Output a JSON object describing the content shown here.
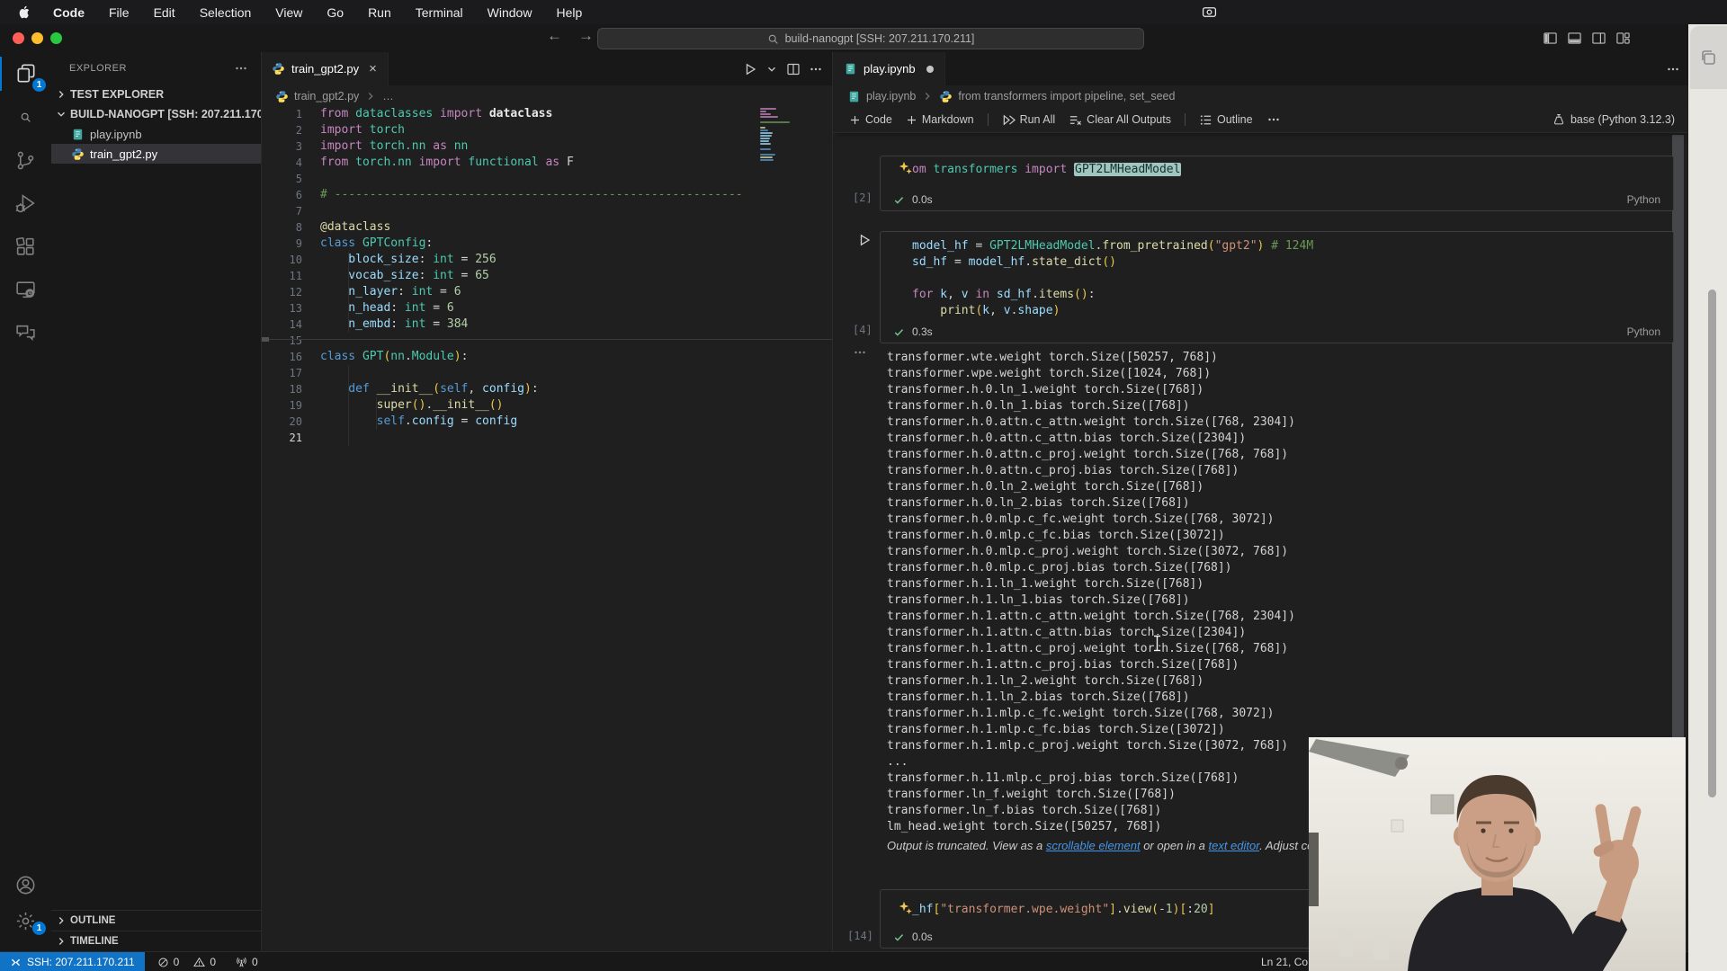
{
  "colors": {
    "accent_blue": "#0078d4",
    "check_green": "#73c991",
    "link_blue": "#4596e8",
    "remote_bg": "#1173c5"
  },
  "menu_bar": {
    "items": [
      "Code",
      "File",
      "Edit",
      "Selection",
      "View",
      "Go",
      "Run",
      "Terminal",
      "Window",
      "Help"
    ]
  },
  "title_bar": {
    "window_title": "build-nanogpt [SSH: 207.211.170.211]",
    "back": "←",
    "forward": "→",
    "layout_buttons": [
      {
        "icon": "layout-sidebar-icon",
        "name": "toggle-primary-sidebar"
      },
      {
        "icon": "layout-panel-icon",
        "name": "toggle-panel"
      },
      {
        "icon": "layout-secondary-icon",
        "name": "toggle-secondary-sidebar"
      },
      {
        "icon": "layout-customize-icon",
        "name": "customize-layout"
      }
    ]
  },
  "activity_bar": {
    "top": [
      {
        "name": "explorer",
        "icon": "files-icon",
        "active": true,
        "badge": "1"
      },
      {
        "name": "search",
        "icon": "search-icon"
      },
      {
        "name": "source-control",
        "icon": "source-control-icon"
      },
      {
        "name": "run-debug",
        "icon": "debug-icon"
      },
      {
        "name": "extensions",
        "icon": "extensions-icon"
      },
      {
        "name": "remote-explorer",
        "icon": "remote-explorer-icon"
      },
      {
        "name": "comments",
        "icon": "comments-icon"
      }
    ],
    "bottom": [
      {
        "name": "accounts",
        "icon": "account-icon"
      },
      {
        "name": "settings",
        "icon": "gear-icon",
        "badge": "1"
      }
    ]
  },
  "sidebar": {
    "title": "EXPLORER",
    "more": "more-icon",
    "sections": [
      {
        "label": "TEST EXPLORER",
        "collapsed": true
      },
      {
        "label": "BUILD-NANOGPT [SSH: 207.211.170....",
        "collapsed": false
      }
    ],
    "files": [
      {
        "label": "play.ipynb",
        "icon": "notebook-icon"
      },
      {
        "label": "train_gpt2.py",
        "icon": "python-icon",
        "selected": true
      }
    ],
    "bottom_sections": [
      {
        "label": "OUTLINE"
      },
      {
        "label": "TIMELINE"
      }
    ]
  },
  "editor": {
    "tab_label": "train_gpt2.py",
    "tab_close": "×",
    "actions": [
      {
        "icon": "run-icon",
        "name": "run-python-file-button"
      },
      {
        "icon": "chevron-down-icon",
        "name": "run-dropdown-button"
      },
      {
        "icon": "split-icon",
        "name": "split-editor-button"
      },
      {
        "icon": "more-icon",
        "name": "editor-more-button"
      }
    ],
    "breadcrumb": [
      {
        "icon": "python-icon",
        "label": "train_gpt2.py"
      },
      {
        "label": "…"
      }
    ],
    "lines": [
      {
        "t": [
          [
            "from",
            "kw"
          ],
          [
            " dataclasses",
            "type"
          ],
          [
            " import",
            "kw"
          ],
          [
            " dataclass",
            "fgb"
          ]
        ]
      },
      {
        "t": [
          [
            "import",
            "kw"
          ],
          [
            " torch",
            "type"
          ]
        ]
      },
      {
        "t": [
          [
            "import",
            "kw"
          ],
          [
            " torch.nn",
            "type"
          ],
          [
            " as",
            "kw"
          ],
          [
            " nn",
            "type"
          ]
        ]
      },
      {
        "t": [
          [
            "from",
            "kw"
          ],
          [
            " torch.nn",
            "type"
          ],
          [
            " import",
            "kw"
          ],
          [
            " functional",
            "type"
          ],
          [
            " as",
            "kw"
          ],
          [
            " F",
            "fg"
          ]
        ]
      },
      {
        "t": []
      },
      {
        "t": [
          [
            "# ----------------------------------------------------------",
            "com"
          ]
        ]
      },
      {
        "t": []
      },
      {
        "t": [
          [
            "@dataclass",
            "func"
          ]
        ]
      },
      {
        "t": [
          [
            "class",
            "ctrl"
          ],
          [
            " GPTConfig",
            "type"
          ],
          [
            ":",
            "fg"
          ]
        ]
      },
      {
        "t": [
          [
            "    block_size",
            "var"
          ],
          [
            ":",
            "fg"
          ],
          [
            " int",
            "type"
          ],
          [
            " = ",
            "fg"
          ],
          [
            "256",
            "num"
          ]
        ]
      },
      {
        "t": [
          [
            "    vocab_size",
            "var"
          ],
          [
            ":",
            "fg"
          ],
          [
            " int",
            "type"
          ],
          [
            " = ",
            "fg"
          ],
          [
            "65",
            "num"
          ]
        ]
      },
      {
        "t": [
          [
            "    n_layer",
            "var"
          ],
          [
            ":",
            "fg"
          ],
          [
            " int",
            "type"
          ],
          [
            " = ",
            "fg"
          ],
          [
            "6",
            "num"
          ]
        ]
      },
      {
        "t": [
          [
            "    n_head",
            "var"
          ],
          [
            ":",
            "fg"
          ],
          [
            " int",
            "type"
          ],
          [
            " = ",
            "fg"
          ],
          [
            "6",
            "num"
          ]
        ]
      },
      {
        "t": [
          [
            "    n_embd",
            "var"
          ],
          [
            ":",
            "fg"
          ],
          [
            " int",
            "type"
          ],
          [
            " = ",
            "fg"
          ],
          [
            "384",
            "num"
          ]
        ]
      },
      {
        "t": []
      },
      {
        "t": [
          [
            "class",
            "ctrl"
          ],
          [
            " GPT",
            "type"
          ],
          [
            "(",
            "par"
          ],
          [
            "nn",
            "type"
          ],
          [
            ".",
            "fg"
          ],
          [
            "Module",
            "type"
          ],
          [
            ")",
            "par"
          ],
          [
            ":",
            "fg"
          ]
        ]
      },
      {
        "t": []
      },
      {
        "t": [
          [
            "    def",
            "ctrl"
          ],
          [
            " __init__",
            "func"
          ],
          [
            "(",
            "par"
          ],
          [
            "self",
            "ctrl"
          ],
          [
            ",",
            "fg"
          ],
          [
            " config",
            "var"
          ],
          [
            ")",
            "par"
          ],
          [
            ":",
            "fg"
          ]
        ]
      },
      {
        "t": [
          [
            "        super",
            "func"
          ],
          [
            "()",
            "par"
          ],
          [
            ".",
            "fg"
          ],
          [
            "__init__",
            "func"
          ],
          [
            "()",
            "par"
          ]
        ]
      },
      {
        "t": [
          [
            "        self",
            "ctrl"
          ],
          [
            ".",
            "fg"
          ],
          [
            "config",
            "var"
          ],
          [
            " = ",
            "fg"
          ],
          [
            "config",
            "var"
          ]
        ]
      },
      {
        "t": []
      }
    ]
  },
  "notebook": {
    "tab_label": "play.ipynb",
    "breadcrumb": [
      {
        "icon": "notebook-icon",
        "label": "play.ipynb"
      },
      {
        "icon": "python-icon",
        "label": "from transformers import pipeline, set_seed"
      }
    ],
    "toolbar": [
      {
        "icon": "add-icon",
        "label": "Code"
      },
      {
        "icon": "add-icon",
        "label": "Markdown"
      },
      {
        "sep": true
      },
      {
        "icon": "run-all-icon",
        "label": "Run All"
      },
      {
        "icon": "clear-outputs-icon",
        "label": "Clear All Outputs"
      },
      {
        "sep": true
      },
      {
        "icon": "outline-icon",
        "label": "Outline"
      },
      {
        "icon": "more-icon",
        "label": ""
      }
    ],
    "kernel": "base (Python 3.12.3)",
    "cells": [
      {
        "exec": "[2]",
        "time": "0.0s",
        "lang": "Python",
        "sparkle": true,
        "code": [
          [
            [
              "om",
              "kw"
            ],
            [
              " transformers",
              "type"
            ],
            [
              " import",
              "kw"
            ],
            [
              " ",
              "fg"
            ],
            [
              "GPT2LMHeadModel",
              "hl"
            ]
          ]
        ]
      },
      {
        "exec": "[4]",
        "time": "0.3s",
        "lang": "Python",
        "run_button": true,
        "code": [
          [
            [
              "model_hf",
              "var"
            ],
            [
              " = ",
              "fg"
            ],
            [
              "GPT2LMHeadModel",
              "type"
            ],
            [
              ".",
              "fg"
            ],
            [
              "from_pretrained",
              "func"
            ],
            [
              "(",
              "par"
            ],
            [
              "\"gpt2\"",
              "str"
            ],
            [
              ")",
              "par"
            ],
            [
              " # 124M",
              "com"
            ]
          ],
          [
            [
              "sd_hf",
              "var"
            ],
            [
              " = ",
              "fg"
            ],
            [
              "model_hf",
              "var"
            ],
            [
              ".",
              "fg"
            ],
            [
              "state_dict",
              "func"
            ],
            [
              "()",
              "par"
            ]
          ],
          [],
          [
            [
              "for",
              "kw"
            ],
            [
              " k",
              "var"
            ],
            [
              ", ",
              "fg"
            ],
            [
              "v",
              "var"
            ],
            [
              " in",
              "kw"
            ],
            [
              " sd_hf",
              "var"
            ],
            [
              ".",
              "fg"
            ],
            [
              "items",
              "func"
            ],
            [
              "()",
              "par"
            ],
            [
              ":",
              "fg"
            ]
          ],
          [
            [
              "    print",
              "func"
            ],
            [
              "(",
              "par"
            ],
            [
              "k",
              "var"
            ],
            [
              ", ",
              "fg"
            ],
            [
              "v",
              "var"
            ],
            [
              ".",
              "fg"
            ],
            [
              "shape",
              "var"
            ],
            [
              ")",
              "par"
            ]
          ]
        ]
      },
      {
        "exec": "[14]",
        "time": "0.0s",
        "sparkle": true,
        "code": [
          [
            [
              "_hf",
              "var"
            ],
            [
              "[",
              "par"
            ],
            [
              "\"transformer.wpe.weight\"",
              "str"
            ],
            [
              "]",
              "par"
            ],
            [
              ".",
              "fg"
            ],
            [
              "view",
              "func"
            ],
            [
              "(",
              "par"
            ],
            [
              "-",
              "fg"
            ],
            [
              "1",
              "num"
            ],
            [
              ")",
              "par"
            ],
            [
              "[",
              "par"
            ],
            [
              ":",
              "fg"
            ],
            [
              "20",
              "num"
            ],
            [
              "]",
              "par"
            ]
          ]
        ]
      }
    ],
    "output": {
      "lines": [
        "transformer.wte.weight torch.Size([50257, 768])",
        "transformer.wpe.weight torch.Size([1024, 768])",
        "transformer.h.0.ln_1.weight torch.Size([768])",
        "transformer.h.0.ln_1.bias torch.Size([768])",
        "transformer.h.0.attn.c_attn.weight torch.Size([768, 2304])",
        "transformer.h.0.attn.c_attn.bias torch.Size([2304])",
        "transformer.h.0.attn.c_proj.weight torch.Size([768, 768])",
        "transformer.h.0.attn.c_proj.bias torch.Size([768])",
        "transformer.h.0.ln_2.weight torch.Size([768])",
        "transformer.h.0.ln_2.bias torch.Size([768])",
        "transformer.h.0.mlp.c_fc.weight torch.Size([768, 3072])",
        "transformer.h.0.mlp.c_fc.bias torch.Size([3072])",
        "transformer.h.0.mlp.c_proj.weight torch.Size([3072, 768])",
        "transformer.h.0.mlp.c_proj.bias torch.Size([768])",
        "transformer.h.1.ln_1.weight torch.Size([768])",
        "transformer.h.1.ln_1.bias torch.Size([768])",
        "transformer.h.1.attn.c_attn.weight torch.Size([768, 2304])",
        "transformer.h.1.attn.c_attn.bias torch.Size([2304])",
        "transformer.h.1.attn.c_proj.weight torch.Size([768, 768])",
        "transformer.h.1.attn.c_proj.bias torch.Size([768])",
        "transformer.h.1.ln_2.weight torch.Size([768])",
        "transformer.h.1.ln_2.bias torch.Size([768])",
        "transformer.h.1.mlp.c_fc.weight torch.Size([768, 3072])",
        "transformer.h.1.mlp.c_fc.bias torch.Size([3072])",
        "transformer.h.1.mlp.c_proj.weight torch.Size([3072, 768])",
        "...",
        "transformer.h.11.mlp.c_proj.bias torch.Size([768])",
        "transformer.ln_f.weight torch.Size([768])",
        "transformer.ln_f.bias torch.Size([768])",
        "lm_head.weight torch.Size([50257, 768])"
      ],
      "truncation": {
        "pre": "Output is truncated. View as a ",
        "link1": "scrollable element",
        "mid": " or open in a ",
        "link2": "text editor",
        "post": ". Adjust cell"
      }
    }
  },
  "status_bar": {
    "remote_label": "SSH: 207.211.170.211",
    "errors": "0",
    "warnings": "0",
    "forwarded": "0",
    "cursor_position": "Ln 21, Co"
  }
}
